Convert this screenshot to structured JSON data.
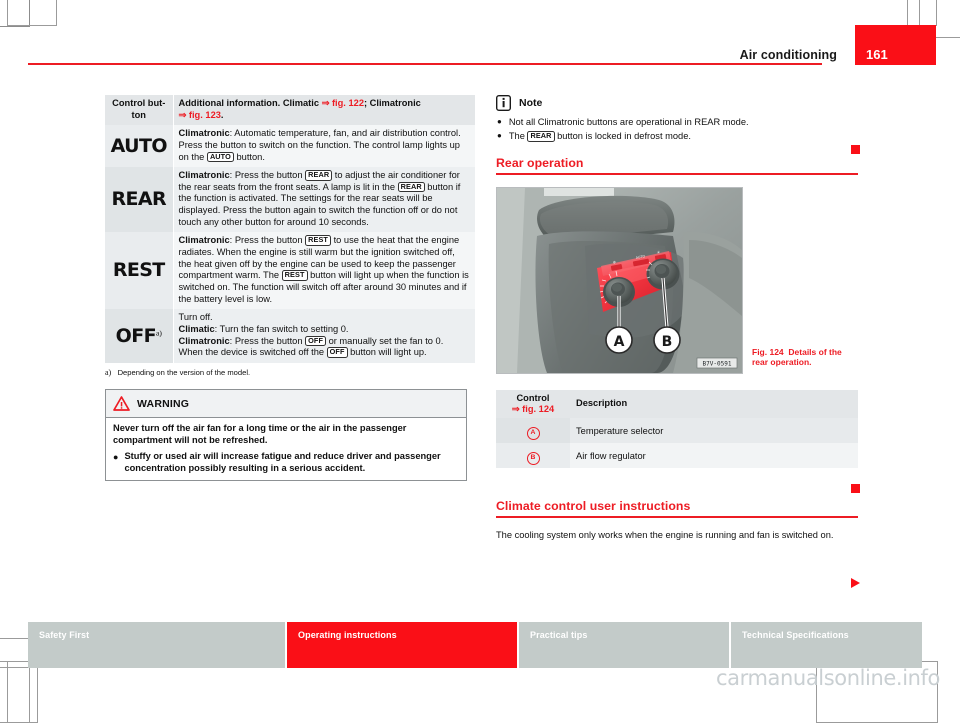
{
  "header": {
    "title": "Air conditioning",
    "page_number": "161"
  },
  "left_column": {
    "control_table": {
      "headers": {
        "col1": "Control but-\nton",
        "col2_prefix": "Additional information. Climatic ",
        "col2_ref1": "⇒ fig. 122",
        "col2_mid": "; Climatronic ",
        "col2_ref2": "⇒ fig. 123",
        "col2_suffix": "."
      },
      "rows": [
        {
          "button": "AUTO",
          "footnote_marker": "",
          "text_lead": "Climatronic",
          "text": ": Automatic temperature, fan, and air distribution control. Press the button to switch on the function. The control lamp lights up on the [AUTO] button."
        },
        {
          "button": "REAR",
          "footnote_marker": "",
          "text_lead": "Climatronic",
          "text": ": Press the button [REAR] to adjust the air conditioner for the rear seats from the front seats. A lamp is lit in the [REAR] button if the function is activated. The settings for the rear seats will be displayed. Press the button again to switch the function off or do not touch any other button for around 10 seconds."
        },
        {
          "button": "REST",
          "footnote_marker": "",
          "text_lead": "Climatronic",
          "text": ": Press the button [REST] to use the heat that the engine radiates. When the engine is still warm but the ignition switched off, the heat given off by the engine can be used to keep the passenger compartment warm. The [REST] button will light up when the function is switched on. The function will switch off after around 30 minutes and if the battery level is low."
        },
        {
          "button": "OFF",
          "footnote_marker": "a)",
          "text_line0": "Turn off.",
          "text_lead": "Climatic",
          "text_line1": ": Turn the fan switch to setting 0.",
          "text_lead2": "Climatronic",
          "text_line2": ": Press the button [OFF] or manually set the fan to 0. When the device is switched off the [OFF] button will light up."
        }
      ],
      "footnote_mark": "a)",
      "footnote_text": "Depending on the version of the model."
    },
    "warning": {
      "icon": "warning-triangle-icon",
      "title": "WARNING",
      "paragraph": "Never turn off the air fan for a long time or the air in the passenger compartment will not be refreshed.",
      "bullet": "Stuffy or used air will increase fatigue and reduce driver and passenger concentration possibly resulting in a serious accident."
    }
  },
  "right_column": {
    "note": {
      "icon": "info-icon",
      "title": "Note",
      "items": [
        "Not all Climatronic buttons are operational in REAR mode.",
        "The [REAR] button is locked in defrost mode."
      ]
    },
    "section_rear": {
      "heading": "Rear operation"
    },
    "figure": {
      "image_code": "B7V-0591",
      "callout_a": "A",
      "callout_b": "B",
      "caption_label": "Fig. 124",
      "caption_text": "Details of the rear operation."
    },
    "control_table": {
      "header_col1_line1": "Control",
      "header_col1_line2": "⇒ fig. 124",
      "header_col2": "Description",
      "rows": [
        {
          "key": "A",
          "description": "Temperature selector"
        },
        {
          "key": "B",
          "description": "Air flow regulator"
        }
      ]
    },
    "section_climate": {
      "heading": "Climate control user instructions",
      "paragraph": "The cooling system only works when the engine is running and fan is switched on."
    }
  },
  "footer": {
    "tabs": [
      {
        "label": "Safety First",
        "active": false
      },
      {
        "label": "Operating instructions",
        "active": true
      },
      {
        "label": "Practical tips",
        "active": false
      },
      {
        "label": "Technical Specifications",
        "active": false
      }
    ],
    "watermark": "carmanualsonline.info"
  },
  "colors": {
    "brand_red": "#ed1c24",
    "marker_red": "#fa0f17",
    "tab_gray": "#c3cbc9",
    "table_header_gray": "#e3e6e8"
  }
}
